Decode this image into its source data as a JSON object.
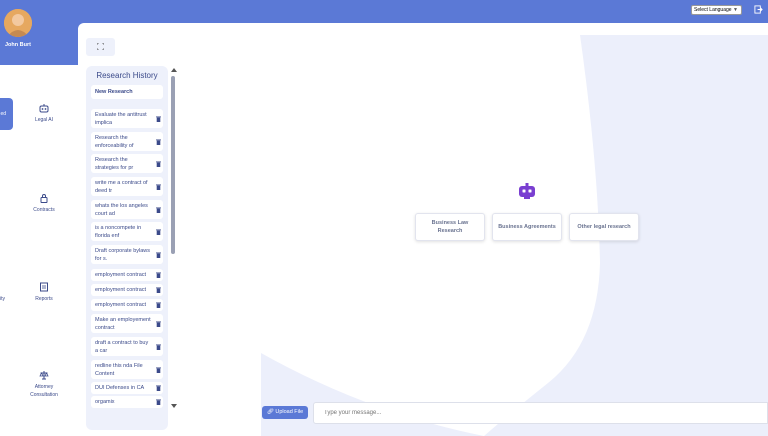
{
  "header": {
    "language_select": "Select Language"
  },
  "user": {
    "name": "John Burt"
  },
  "sidebar": {
    "active_partial": "ed",
    "items": [
      {
        "label": "Legal AI",
        "icon": "robot-icon"
      },
      {
        "label": "Contracts",
        "icon": "lock-icon"
      },
      {
        "label": "Reports",
        "icon": "report-icon"
      },
      {
        "label": "Attorney",
        "label2": "Consultation",
        "icon": "scale-icon"
      }
    ],
    "side_partial": "ity"
  },
  "history": {
    "title": "Research History",
    "new_label": "New Research",
    "items": [
      "Evaluate the antitrust implica",
      "Research the enforceability of",
      "Research the strategies for pr",
      "write me a contract of deed tr",
      "whats the los angeles court ad",
      "is a noncompete in florida enf",
      "Draft corporate bylaws for s.",
      "employment contract",
      "employment contract",
      "employment contract",
      "Make an employement contract",
      "draft a contract to buy a car",
      "redline this nda File Content",
      "DUI Defenses in CA",
      "orgamix"
    ]
  },
  "suggestions": [
    "Business Law Research",
    "Business Agreements",
    "Other legal research"
  ],
  "composer": {
    "upload_label": "Upload File",
    "placeholder": "Type your message..."
  },
  "colors": {
    "accent": "#5b79d6",
    "panel": "#eef1fb",
    "bot": "#7a3fd1"
  }
}
